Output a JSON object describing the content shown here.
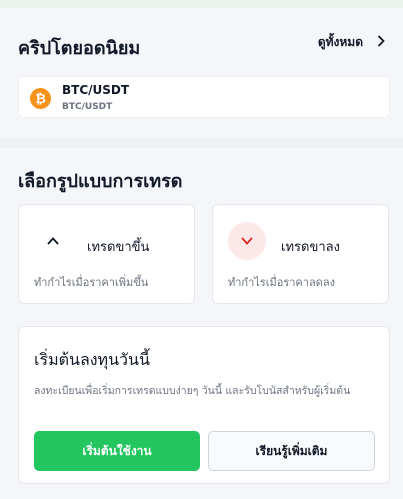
{
  "popular": {
    "title": "คริปโตยอดนิยม",
    "see_all": "ดูทั้งหมด",
    "items": [
      {
        "icon_char": "₿",
        "icon": "bitcoin-icon",
        "name": "BTC/USDT",
        "sub": "BTC/USDT",
        "color": "#f7931a"
      }
    ]
  },
  "trade_type": {
    "title": "เลือกรูปแบบการเทรด",
    "up": {
      "label": "เทรดขาขึ้น",
      "desc": "ทำกำไรเมื่อราคาเพิ่มขึ้น",
      "icon": "chevron-up-icon"
    },
    "down": {
      "label": "เทรดขาลง",
      "desc": "ทำกำไรเมื่อราคาลดลง",
      "icon": "chevron-down-icon",
      "icon_bg": "#fde8e8",
      "icon_color": "#dc2626"
    }
  },
  "start": {
    "title": "เริ่มต้นลงทุนวันนี้",
    "desc": "ลงทะเบียนเพื่อเริ่มการเทรดแบบง่ายๆ วันนี้ และรับโบนัสสำหรับผู้เริ่มต้น",
    "primary_button": "เริ่มต้นใช้งาน",
    "secondary_button": "เรียนรู้เพิ่มเติม"
  },
  "colors": {
    "accent": "#22c55e",
    "down": "#dc2626",
    "bitcoin": "#f7931a"
  }
}
